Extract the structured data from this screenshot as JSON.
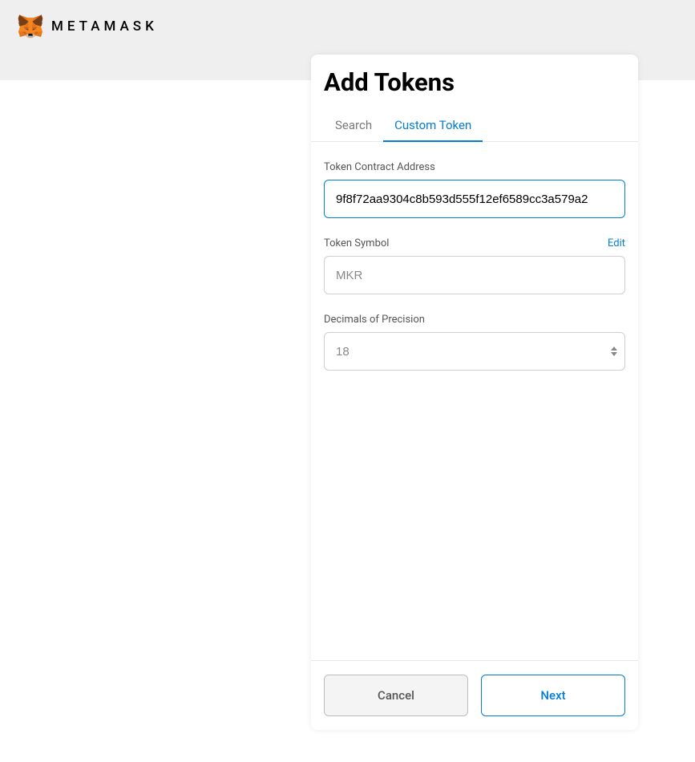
{
  "brand": {
    "name": "METAMASK"
  },
  "modal": {
    "title": "Add Tokens",
    "tabs": {
      "search": "Search",
      "custom": "Custom Token"
    },
    "form": {
      "address_label": "Token Contract Address",
      "address_value": "9f8f72aa9304c8b593d555f12ef6589cc3a579a2",
      "symbol_label": "Token Symbol",
      "symbol_value": "MKR",
      "edit_label": "Edit",
      "decimals_label": "Decimals of Precision",
      "decimals_value": "18"
    },
    "footer": {
      "cancel": "Cancel",
      "next": "Next"
    }
  }
}
